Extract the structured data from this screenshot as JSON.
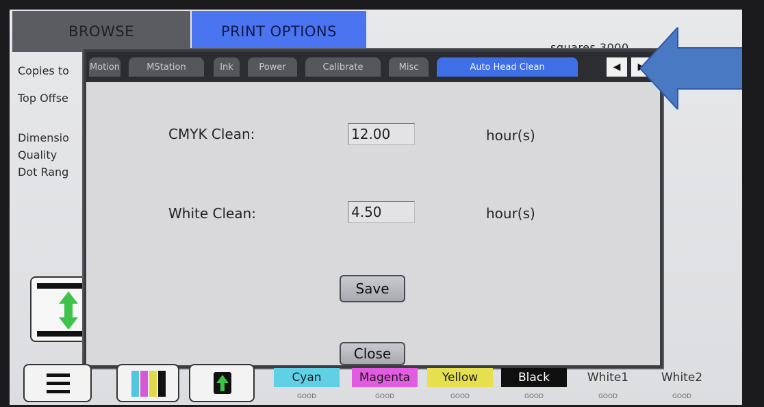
{
  "tabs": {
    "browse": "BROWSE",
    "print_options": "PRINT OPTIONS"
  },
  "brand": "squares 3000",
  "background_labels": [
    "Copies to",
    "Top Offse",
    "Dimensio",
    "Quality",
    "Dot Rang"
  ],
  "dialog": {
    "tabs": [
      "Motion",
      "MStation",
      "Ink",
      "Power",
      "Calibrate",
      "Misc",
      "Auto Head Clean"
    ],
    "active_tab": "Auto Head Clean",
    "cmyk_label": "CMYK Clean:",
    "cmyk_value": "12.00",
    "cmyk_unit": "hour(s)",
    "white_label": "White Clean:",
    "white_value": "4.50",
    "white_unit": "hour(s)",
    "save_label": "Save",
    "close_label": "Close"
  },
  "inks": [
    {
      "name": "Cyan",
      "status": "GOOD",
      "color": "#5fd0e6"
    },
    {
      "name": "Magenta",
      "status": "GOOD",
      "color": "#e25be0"
    },
    {
      "name": "Yellow",
      "status": "GOOD",
      "color": "#e6e04e"
    },
    {
      "name": "Black",
      "status": "GOOD",
      "color": "#0f0f10"
    },
    {
      "name": "White1",
      "status": "GOOD",
      "color": "#f4f4f4"
    },
    {
      "name": "White2",
      "status": "GOOD",
      "color": "#f4f4f4"
    }
  ],
  "colors": {
    "accent_blue": "#4a74f0",
    "arrow_blue": "#4a79c4"
  }
}
